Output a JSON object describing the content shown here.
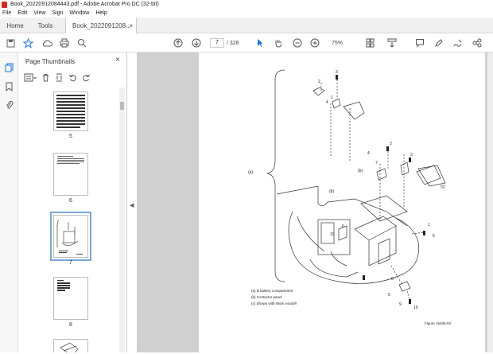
{
  "window": {
    "title": "Book_20220912084443.pdf - Adobe Acrobat Pro DC (32-bit)"
  },
  "menu": [
    "File",
    "Edit",
    "View",
    "Sign",
    "Window",
    "Help"
  ],
  "tabs": {
    "home": "Home",
    "tools": "Tools",
    "doc": "Book_20220912​08...",
    "close": "×"
  },
  "toolbar": {
    "page_current": "7",
    "page_total": "/ 328",
    "zoom": "75%"
  },
  "panel": {
    "title": "Page Thumbnails",
    "close": "×"
  },
  "thumbnails": [
    {
      "label": "5"
    },
    {
      "label": "6"
    },
    {
      "label": "7",
      "selected": true
    },
    {
      "label": "8"
    }
  ],
  "figure": {
    "legend": [
      "(a)   B battery compartment",
      "(b)   Contactor panel",
      "(c)   Shown with Work Assist®"
    ],
    "caption": "Figure 15406-03",
    "callouts": [
      "2",
      "3",
      "4",
      "1",
      "2",
      "3",
      "7",
      "4",
      "1",
      "6",
      "10",
      "8",
      "5",
      "9",
      "10",
      "6"
    ],
    "side_labels": [
      "(a)",
      "(b)",
      "(b)",
      "(c)"
    ]
  }
}
